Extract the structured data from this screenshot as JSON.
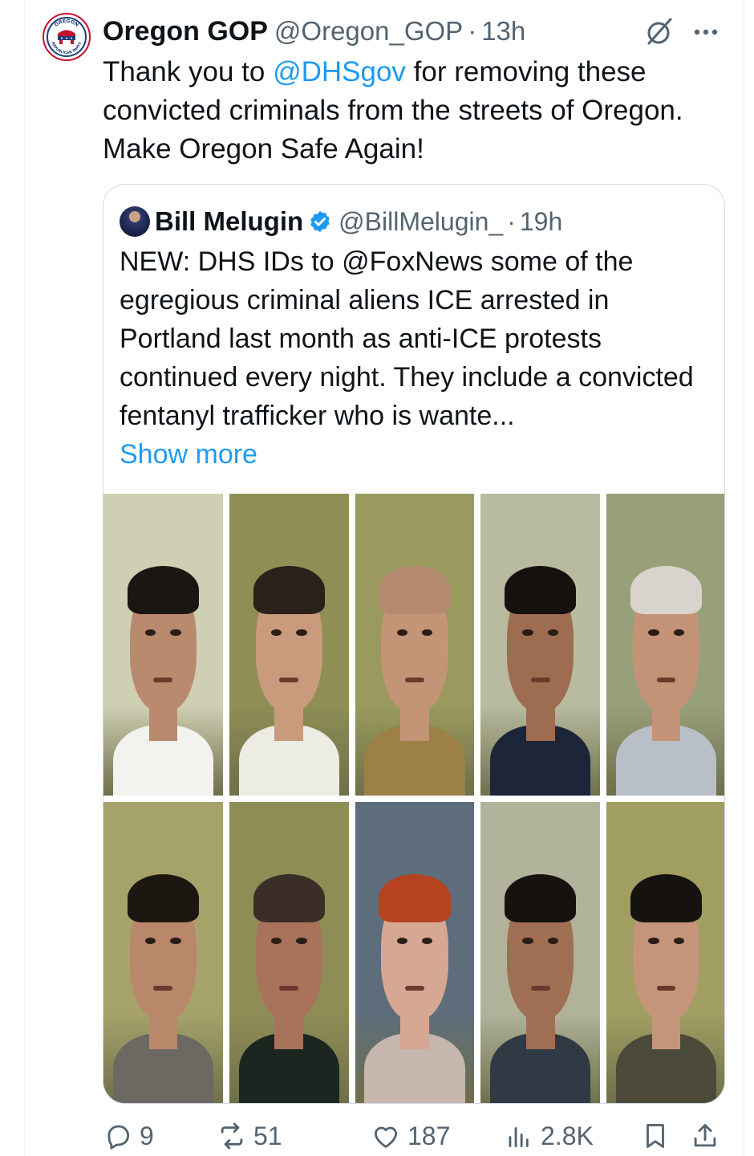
{
  "tweet": {
    "author_name": "Oregon GOP",
    "author_handle": "@Oregon_GOP",
    "separator": "·",
    "time": "13h",
    "text_before": "Thank you to ",
    "mention": "@DHSgov",
    "text_after": " for removing these convicted criminals from the streets of Oregon. Make Oregon Safe Again!",
    "avatar_text_top": "OREGON",
    "avatar_text_bottom": "REPUBLICAN PARTY"
  },
  "quote": {
    "author_name": "Bill Melugin",
    "author_handle": "@BillMelugin_",
    "separator": "·",
    "time": "19h",
    "text": "NEW: DHS IDs to @FoxNews some of the egregious criminal aliens ICE arrested in Portland last month as anti-ICE protests continued every night. They include a convicted fentanyl trafficker who is wante...",
    "show_more": "Show more"
  },
  "actions": {
    "replies": "9",
    "reposts": "51",
    "likes": "187",
    "views": "2.8K"
  },
  "colors": {
    "accent": "#1d9bf0",
    "muted": "#536471",
    "text": "#0f1419",
    "border": "#cfd9de"
  },
  "photos": [
    {
      "label": "mugshot-1",
      "bg": "#cfcfb4",
      "skin": "#b98a6e",
      "hair": "#1c1612",
      "shirt": "#f2f2ee"
    },
    {
      "label": "mugshot-2",
      "bg": "#8e8e55",
      "skin": "#c99a7b",
      "hair": "#2a211b",
      "shirt": "#ecebe4"
    },
    {
      "label": "mugshot-3",
      "bg": "#9a9a5e",
      "skin": "#c49477",
      "hair": "#b38a70",
      "shirt": "#9c8046"
    },
    {
      "label": "mugshot-4",
      "bg": "#b8bba0",
      "skin": "#9e6c50",
      "hair": "#14110f",
      "shirt": "#1d2538"
    },
    {
      "label": "mugshot-5",
      "bg": "#98a07a",
      "skin": "#c39277",
      "hair": "#d8d3cc",
      "shirt": "#b8bfc6"
    },
    {
      "label": "mugshot-6",
      "bg": "#a5a36a",
      "skin": "#b9876a",
      "hair": "#1d1712",
      "shirt": "#6c6862"
    },
    {
      "label": "mugshot-7",
      "bg": "#8f8d56",
      "skin": "#a8735a",
      "hair": "#3a2e27",
      "shirt": "#1c2620"
    },
    {
      "label": "mugshot-8",
      "bg": "#5e6d7c",
      "skin": "#d6a792",
      "hair": "#b5431f",
      "shirt": "#c6b6ae"
    },
    {
      "label": "mugshot-9",
      "bg": "#b0b39a",
      "skin": "#a06f53",
      "hair": "#16120f",
      "shirt": "#2f3a44"
    },
    {
      "label": "mugshot-10",
      "bg": "#a19e62",
      "skin": "#c4957a",
      "hair": "#16120f",
      "shirt": "#4b4a3a"
    }
  ]
}
